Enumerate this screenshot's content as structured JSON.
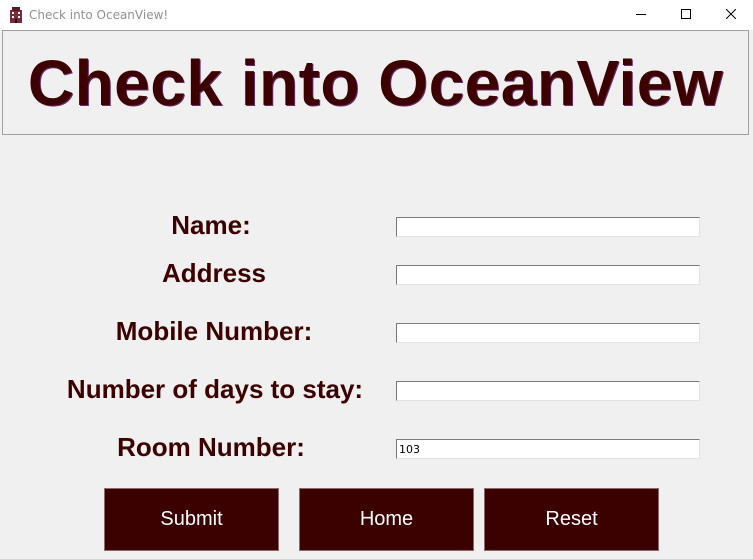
{
  "window": {
    "title": "Check into OceanView!",
    "icons": {
      "app": "hotel-icon",
      "minimize": "minimize-icon",
      "maximize": "maximize-icon",
      "close": "close-icon"
    }
  },
  "header": {
    "title": "Check into OceanView"
  },
  "form": {
    "fields": [
      {
        "label": "Name:",
        "value": ""
      },
      {
        "label": "Address",
        "value": ""
      },
      {
        "label": "Mobile Number:",
        "value": ""
      },
      {
        "label": "Number of days to stay:",
        "value": ""
      },
      {
        "label": "Room Number:",
        "value": "103"
      }
    ]
  },
  "actions": {
    "submit_label": "Submit",
    "home_label": "Home",
    "reset_label": "Reset"
  },
  "colors": {
    "text_dark_red": "#3d0000",
    "button_bg": "#3b0000",
    "window_bg": "#f0f0f0"
  }
}
